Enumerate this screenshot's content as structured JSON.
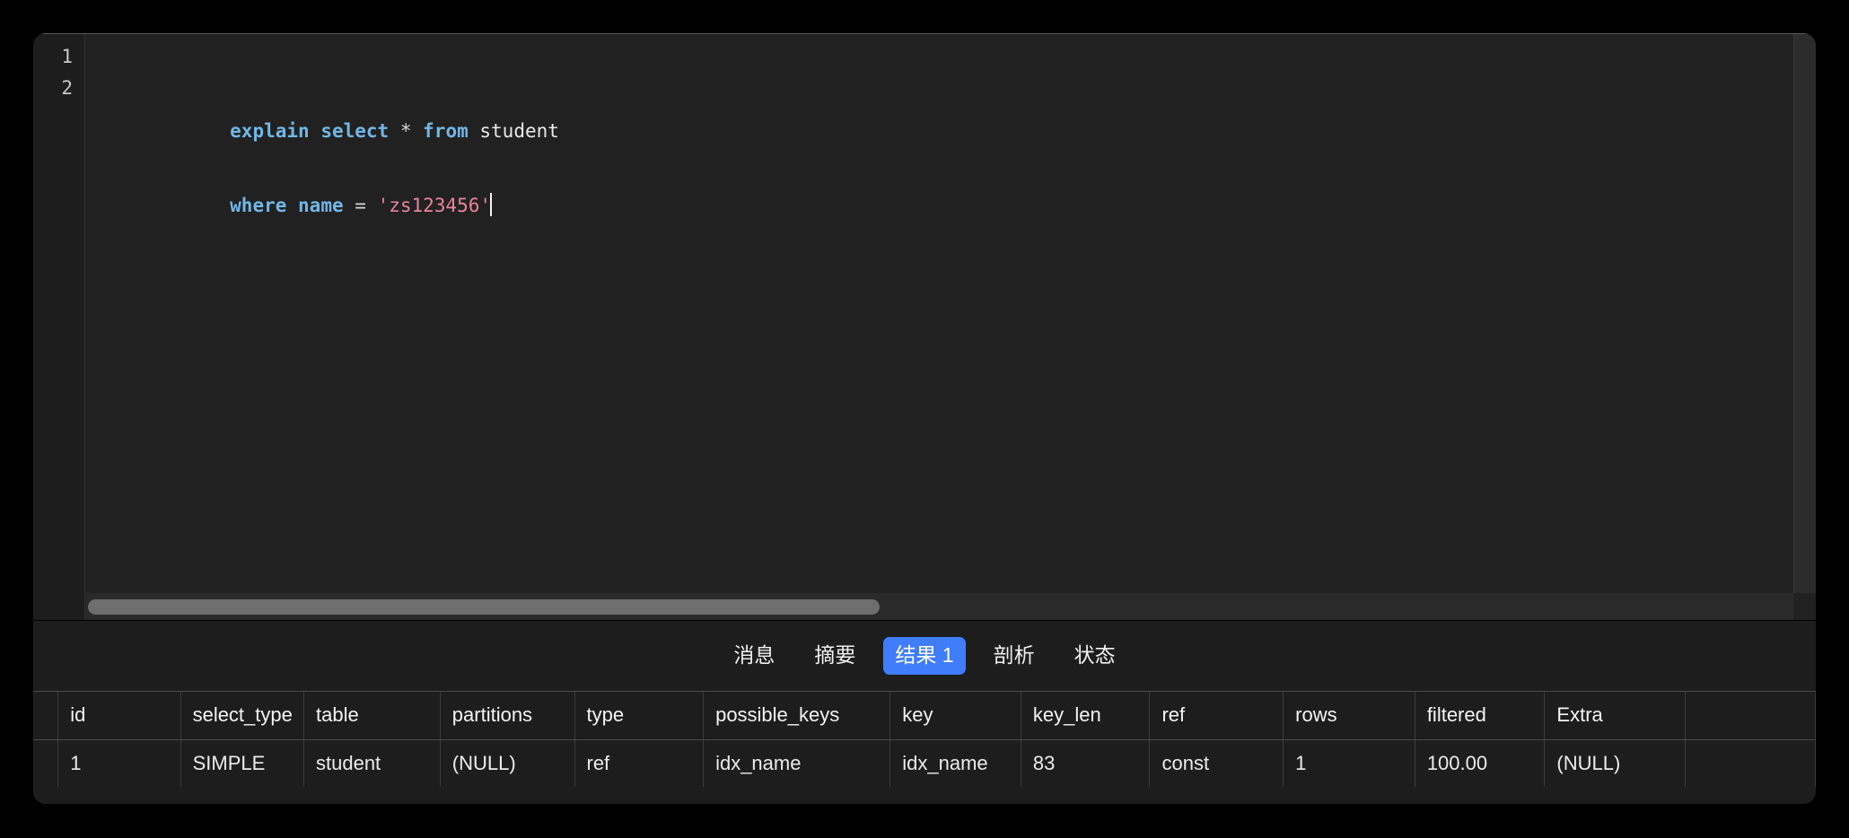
{
  "theme": {
    "page_bg": "#000000",
    "window_bg": "#1d1d1d",
    "editor_bg": "#212121",
    "accent": "#3f7dfb",
    "keyword_color": "#71b7e6",
    "string_color": "#e8849c",
    "null_color": "#8d8d8d",
    "scrollbar_thumb": "#6e6e6e"
  },
  "editor": {
    "line_numbers": [
      "1",
      "2"
    ],
    "lines": [
      {
        "tokens": [
          {
            "text": "explain",
            "kind": "keyword"
          },
          {
            "text": " ",
            "kind": "plain"
          },
          {
            "text": "select",
            "kind": "keyword"
          },
          {
            "text": " ",
            "kind": "plain"
          },
          {
            "text": "*",
            "kind": "operator"
          },
          {
            "text": " ",
            "kind": "plain"
          },
          {
            "text": "from",
            "kind": "keyword"
          },
          {
            "text": " ",
            "kind": "plain"
          },
          {
            "text": "student",
            "kind": "identifier"
          }
        ]
      },
      {
        "tokens": [
          {
            "text": "where",
            "kind": "keyword"
          },
          {
            "text": " ",
            "kind": "plain"
          },
          {
            "text": "name",
            "kind": "keyword"
          },
          {
            "text": " ",
            "kind": "plain"
          },
          {
            "text": "=",
            "kind": "operator"
          },
          {
            "text": " ",
            "kind": "plain"
          },
          {
            "text": "'zs123456'",
            "kind": "string"
          }
        ]
      }
    ],
    "plain_text": "explain select * from student\nwhere name = 'zs123456'",
    "horizontal_scrollbar": {
      "name": "editor-horizontal-scrollbar"
    },
    "vertical_scrollbar": {
      "name": "editor-vertical-scrollbar"
    }
  },
  "results": {
    "tabs": [
      {
        "id": "messages",
        "label": "消息",
        "active": false
      },
      {
        "id": "summary",
        "label": "摘要",
        "active": false
      },
      {
        "id": "result1",
        "label": "结果 1",
        "active": true
      },
      {
        "id": "profile",
        "label": "剖析",
        "active": false
      },
      {
        "id": "status",
        "label": "状态",
        "active": false
      }
    ],
    "table": {
      "columns": [
        "id",
        "select_type",
        "table",
        "partitions",
        "type",
        "possible_keys",
        "key",
        "key_len",
        "ref",
        "rows",
        "filtered",
        "Extra",
        ""
      ],
      "rows": [
        {
          "id": "1",
          "select_type": "SIMPLE",
          "table": "student",
          "partitions": "(NULL)",
          "type": "ref",
          "possible_keys": "idx_name",
          "key": "idx_name",
          "key_len": "83",
          "ref": "const",
          "rows": "1",
          "filtered": "100.00",
          "Extra": "(NULL)",
          "tail": ""
        }
      ]
    }
  }
}
